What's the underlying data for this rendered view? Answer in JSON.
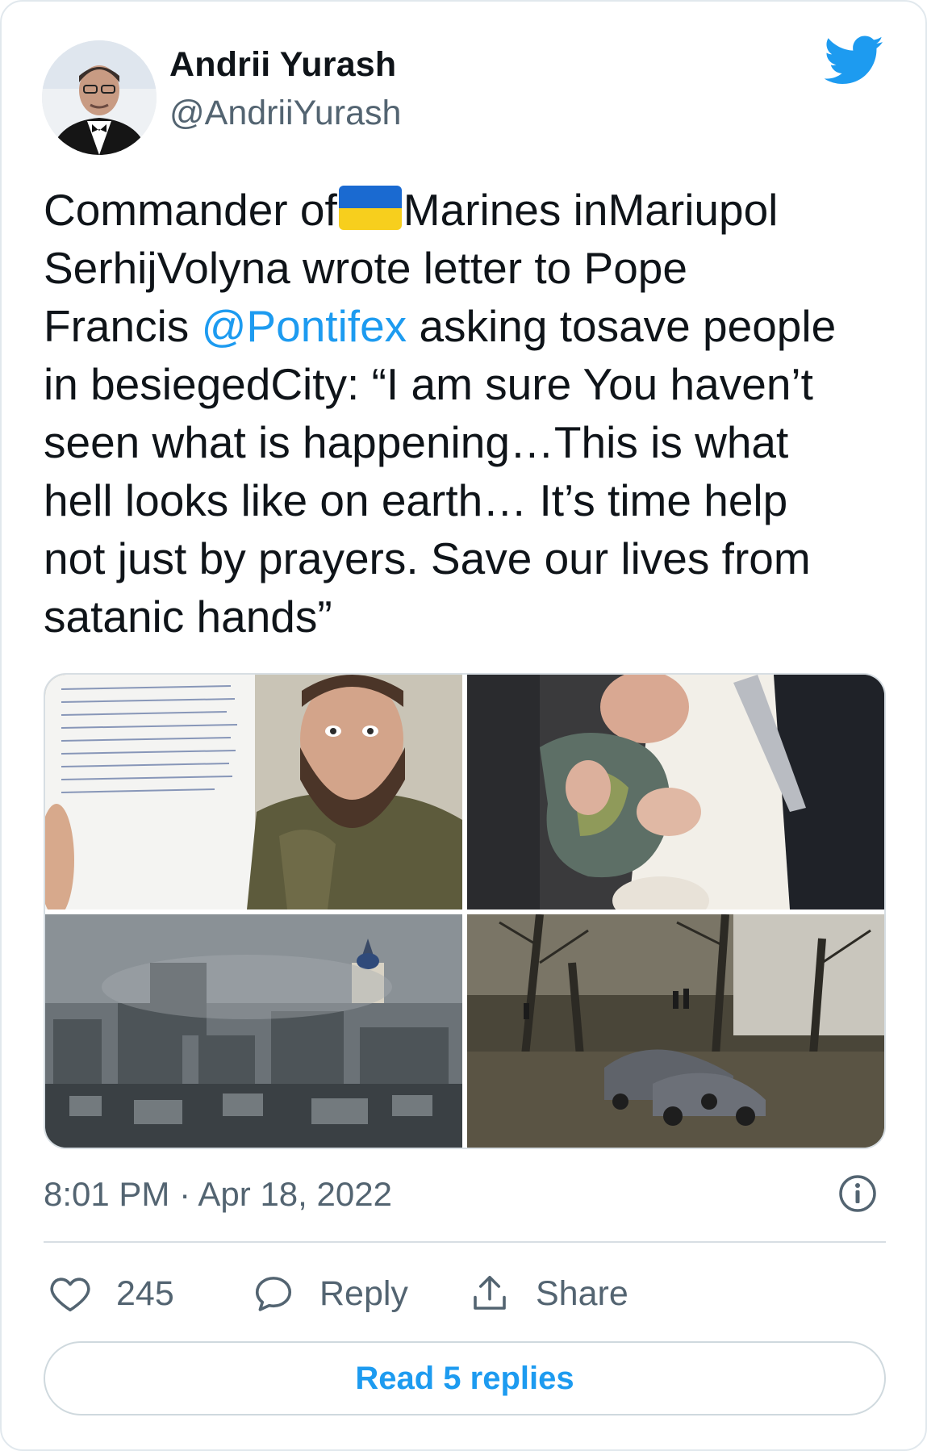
{
  "author": {
    "name": "Andrii Yurash",
    "handle": "@AndriiYurash",
    "avatar_icon": "profile-photo"
  },
  "platform_icon": "twitter-bird-icon",
  "tweet": {
    "lines": [
      [
        "Commander of",
        "FLAG",
        "Marines inMariupol"
      ],
      [
        "SerhijVolyna wrote letter to Pope"
      ],
      [
        "Francis ",
        "@Pontifex",
        " asking tosave people"
      ],
      [
        "in besiegedCity: “I am sure You haven’t"
      ],
      [
        "seen what is happening…This is what"
      ],
      [
        "hell looks like on earth… It’s time help"
      ],
      [
        "not just by prayers. Save our lives from"
      ],
      [
        "satanic hands”"
      ]
    ],
    "l1a": "Commander of",
    "l1b": "Marines inMariupol",
    "l2": "SerhijVolyna wrote letter to Pope",
    "l3a": "Francis ",
    "l3_mention": "@Pontifex",
    "l3b": " asking tosave people",
    "l4": "in besiegedCity: “I am sure You haven’t",
    "l5": "seen what is happening…This is what",
    "l6": "hell looks like on earth… It’s time help",
    "l7": "not just by prayers. Save our lives from",
    "l8": "satanic hands”",
    "flag_icon": "ukraine-flag-emoji"
  },
  "media": [
    {
      "name": "handwritten-letter-and-bearded-marine-photo"
    },
    {
      "name": "pope-kissing-flag-photo"
    },
    {
      "name": "mariupol-city-smoke-photo"
    },
    {
      "name": "destroyed-cars-courtyard-photo"
    }
  ],
  "timestamp": "8:01 PM · Apr 18, 2022",
  "actions": {
    "like_count": "245",
    "reply_label": "Reply",
    "share_label": "Share"
  },
  "read_replies_label": "Read 5 replies",
  "colors": {
    "accent": "#1d9bf0",
    "text": "#0f1419",
    "secondary": "#536471",
    "border": "#d7dee3"
  }
}
